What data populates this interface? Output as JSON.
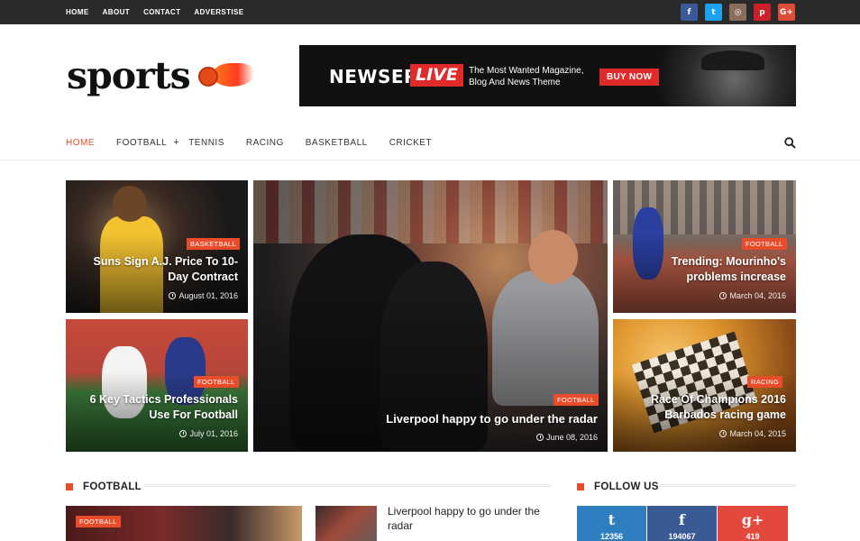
{
  "topbar": {
    "links": [
      "HOME",
      "ABOUT",
      "CONTACT",
      "ADVERSTISE"
    ],
    "social": [
      {
        "icon": "facebook-icon",
        "glyph": "f",
        "color": "#3b5998"
      },
      {
        "icon": "twitter-icon",
        "glyph": "t",
        "color": "#1da1f2"
      },
      {
        "icon": "instagram-icon",
        "glyph": "◎",
        "color": "#8a6d5a"
      },
      {
        "icon": "pinterest-icon",
        "glyph": "p",
        "color": "#cb2027"
      },
      {
        "icon": "google-plus-icon",
        "glyph": "G+",
        "color": "#dd4b39"
      }
    ]
  },
  "header": {
    "logo_text": "sports",
    "banner": {
      "brand": "NEWSER",
      "brand_live": "LIVE",
      "tagline": "The Most Wanted Magazine, Blog And News Theme",
      "button": "BUY NOW"
    }
  },
  "nav": {
    "items": [
      "HOME",
      "FOOTBALL",
      "TENNIS",
      "RACING",
      "BASKETBALL",
      "CRICKET"
    ],
    "active": "HOME",
    "plus": "+"
  },
  "featured": [
    {
      "category": "BASKETBALL",
      "title": "Suns Sign A.J. Price To 10-Day Contract",
      "date": "August 01, 2016"
    },
    {
      "category": "FOOTBALL",
      "title": "6 Key Tactics Professionals Use For Football",
      "date": "July 01, 2016"
    },
    {
      "category": "FOOTBALL",
      "title": "Liverpool happy to go under the radar",
      "date": "June 08, 2016"
    },
    {
      "category": "FOOTBALL",
      "title": "Trending: Mourinho's problems increase",
      "date": "March 04, 2016"
    },
    {
      "category": "RACING",
      "title": "Race Of Champions 2016 Barbados racing game",
      "date": "March 04, 2015"
    }
  ],
  "sections": {
    "football_title": "FOOTBALL",
    "follow_title": "FOLLOW US",
    "football_badge": "FOOTBALL",
    "side_post_title": "Liverpool happy to go under the radar"
  },
  "follow": [
    {
      "icon": "twitter-icon",
      "glyph": "t",
      "count": "12356",
      "color": "#2f7fc0"
    },
    {
      "icon": "facebook-icon",
      "glyph": "f",
      "count": "194067",
      "color": "#3a5a96"
    },
    {
      "icon": "google-plus-icon",
      "glyph": "g+",
      "count": "419",
      "color": "#e2483c"
    }
  ],
  "colors": {
    "accent": "#e84c2b",
    "topbar": "#2a2a2a"
  }
}
